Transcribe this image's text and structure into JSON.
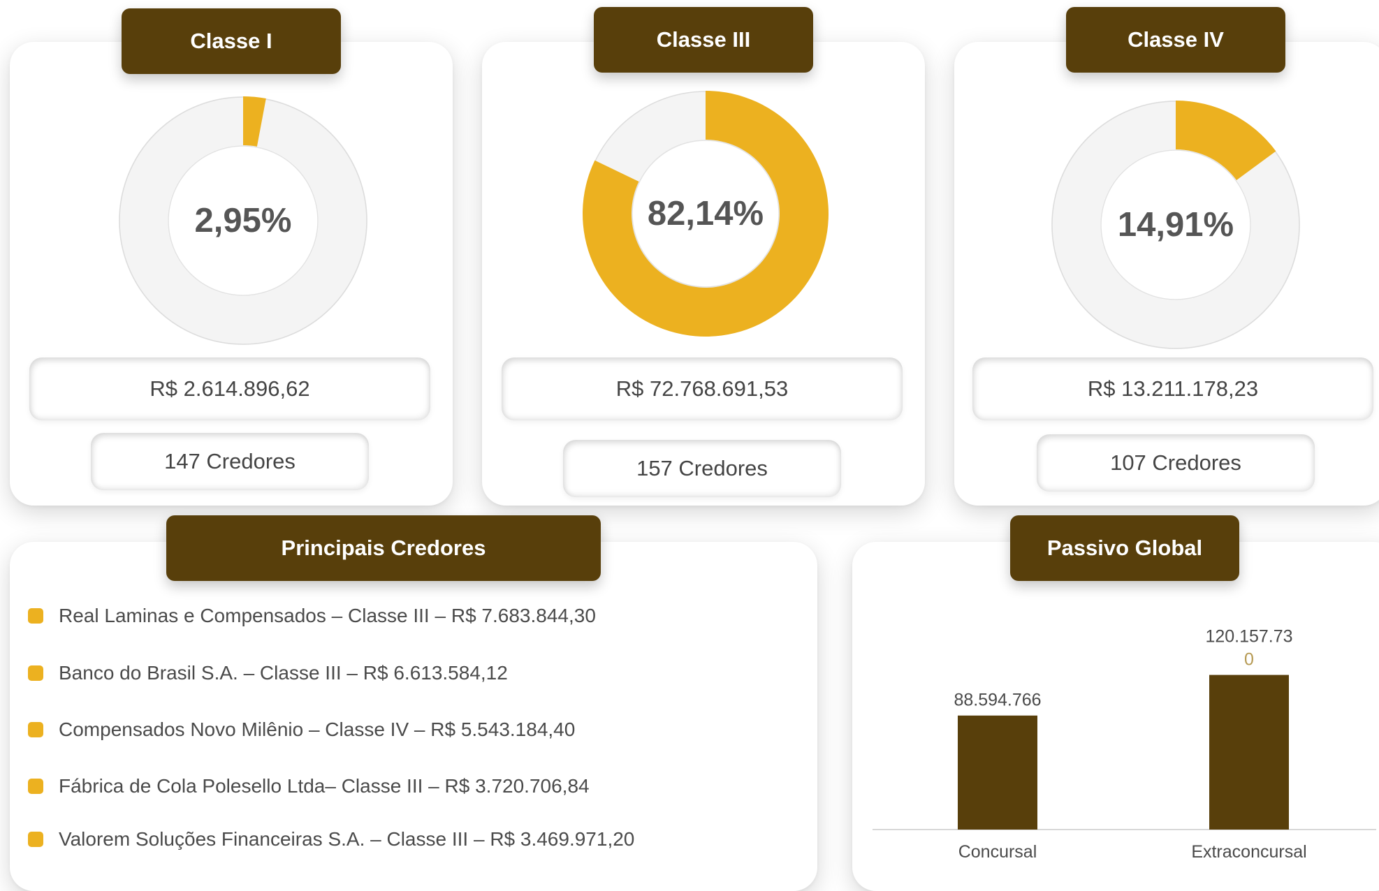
{
  "colors": {
    "brown": "#583f0b",
    "gold": "#ecb120",
    "ring": "#f4f4f4",
    "text": "#4a4a4a"
  },
  "classes": [
    {
      "title": "Classe I",
      "percent_label": "2,95%",
      "percent": 2.95,
      "value": "R$ 2.614.896,62",
      "creditors": "147 Credores"
    },
    {
      "title": "Classe III",
      "percent_label": "82,14%",
      "percent": 82.14,
      "value": "R$ 72.768.691,53",
      "creditors": "157 Credores"
    },
    {
      "title": "Classe IV",
      "percent_label": "14,91%",
      "percent": 14.91,
      "value": "R$ 13.211.178,23",
      "creditors": "107 Credores"
    }
  ],
  "principais": {
    "title": "Principais Credores",
    "items": [
      "Real Laminas e Compensados – Classe III – R$ 7.683.844,30",
      "Banco do Brasil S.A. – Classe III – R$ 6.613.584,12",
      "Compensados Novo Milênio – Classe IV – R$ 5.543.184,40",
      "Fábrica de Cola Polesello Ltda– Classe III – R$ 3.720.706,84",
      "Valorem Soluções Financeiras S.A. – Classe III – R$ 3.469.971,20"
    ]
  },
  "chart_data": {
    "type": "bar",
    "title": "Passivo Global",
    "categories": [
      "Concursal",
      "Extraconcursal"
    ],
    "values": [
      88594766,
      120157730
    ],
    "data_labels": [
      [
        "88.594.766"
      ],
      [
        "120.157.73",
        "0"
      ]
    ],
    "ylim": [
      0,
      140000000
    ],
    "grid": false,
    "bar_color": "#583f0b"
  }
}
